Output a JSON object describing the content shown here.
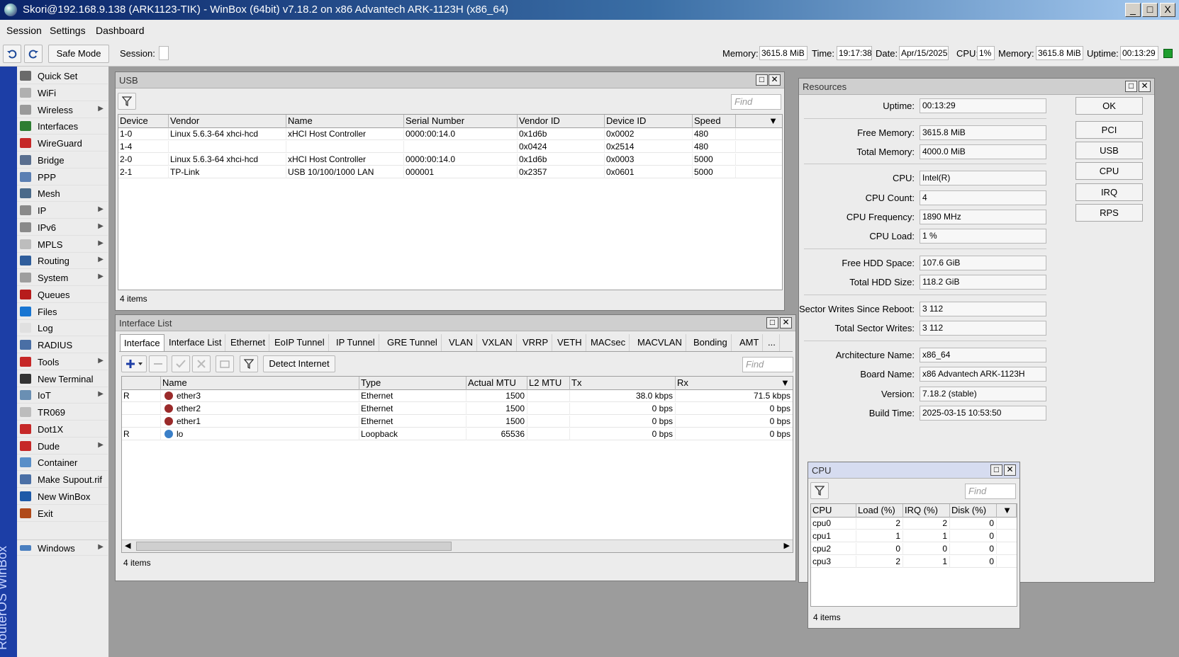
{
  "window": {
    "title": "Skori@192.168.9.138 (ARK1123-TIK) - WinBox (64bit) v7.18.2 on x86 Advantech ARK-1123H (x86_64)",
    "controls": [
      "_",
      "□",
      "X"
    ]
  },
  "menu": [
    "Session",
    "Settings",
    "Dashboard"
  ],
  "toolbar": {
    "undo_icon": "undo-icon",
    "redo_icon": "redo-icon",
    "safe_mode": "Safe Mode",
    "session_label": "Session:",
    "status": {
      "memory_label": "Memory:",
      "memory": "3615.8 MiB",
      "time_label": "Time:",
      "time": "19:17:38",
      "date_label": "Date:",
      "date": "Apr/15/2025",
      "cpu_label": "CPU:",
      "cpu": "1%",
      "memory2_label": "Memory:",
      "memory2": "3615.8 MiB",
      "uptime_label": "Uptime:",
      "uptime": "00:13:29"
    }
  },
  "brand": "RouterOS WinBox",
  "sidebar": [
    {
      "label": "Quick Set",
      "icon": "wand-icon",
      "color": "#6a6a6a",
      "arrow": false
    },
    {
      "label": "WiFi",
      "icon": "wifi-icon",
      "color": "#b0b0b0",
      "arrow": false
    },
    {
      "label": "Wireless",
      "icon": "antenna-icon",
      "color": "#9a9a9a",
      "arrow": true
    },
    {
      "label": "Interfaces",
      "icon": "interfaces-icon",
      "color": "#2e7d32",
      "arrow": false
    },
    {
      "label": "WireGuard",
      "icon": "wireguard-icon",
      "color": "#c62828",
      "arrow": false
    },
    {
      "label": "Bridge",
      "icon": "bridge-icon",
      "color": "#5a6f8f",
      "arrow": false
    },
    {
      "label": "PPP",
      "icon": "ppp-icon",
      "color": "#5b7fb3",
      "arrow": false
    },
    {
      "label": "Mesh",
      "icon": "mesh-icon",
      "color": "#4a6a8a",
      "arrow": false
    },
    {
      "label": "IP",
      "icon": "ip-icon",
      "color": "#8a8a8a",
      "arrow": true
    },
    {
      "label": "IPv6",
      "icon": "ipv6-icon",
      "color": "#8a8a8a",
      "arrow": true
    },
    {
      "label": "MPLS",
      "icon": "mpls-icon",
      "color": "#bdbdbd",
      "arrow": true
    },
    {
      "label": "Routing",
      "icon": "routing-icon",
      "color": "#2f5d9b",
      "arrow": true
    },
    {
      "label": "System",
      "icon": "gear-icon",
      "color": "#9e9e9e",
      "arrow": true
    },
    {
      "label": "Queues",
      "icon": "queues-icon",
      "color": "#b71c1c",
      "arrow": false
    },
    {
      "label": "Files",
      "icon": "folder-icon",
      "color": "#1976d2",
      "arrow": false
    },
    {
      "label": "Log",
      "icon": "log-icon",
      "color": "#e0e0e0",
      "arrow": false
    },
    {
      "label": "RADIUS",
      "icon": "radius-icon",
      "color": "#4a6fa5",
      "arrow": false
    },
    {
      "label": "Tools",
      "icon": "tools-icon",
      "color": "#c62828",
      "arrow": true
    },
    {
      "label": "New Terminal",
      "icon": "terminal-icon",
      "color": "#333333",
      "arrow": false
    },
    {
      "label": "IoT",
      "icon": "iot-icon",
      "color": "#6a8fb3",
      "arrow": true
    },
    {
      "label": "TR069",
      "icon": "tr069-icon",
      "color": "#bdbdbd",
      "arrow": false
    },
    {
      "label": "Dot1X",
      "icon": "dot1x-icon",
      "color": "#c62828",
      "arrow": false
    },
    {
      "label": "Dude",
      "icon": "dude-icon",
      "color": "#c62828",
      "arrow": true
    },
    {
      "label": "Container",
      "icon": "container-icon",
      "color": "#5a8fc8",
      "arrow": false
    },
    {
      "label": "Make Supout.rif",
      "icon": "supout-icon",
      "color": "#4a6fa5",
      "arrow": false
    },
    {
      "label": "New WinBox",
      "icon": "winbox-icon",
      "color": "#1e5aa8",
      "arrow": false
    },
    {
      "label": "Exit",
      "icon": "exit-icon",
      "color": "#b04a1a",
      "arrow": false
    }
  ],
  "sidebar_windows": {
    "label": "Windows",
    "icon": "windows-icon",
    "color": "#4a7fc0"
  },
  "usb": {
    "title": "USB",
    "find_placeholder": "Find",
    "columns": [
      "Device",
      "Vendor",
      "Name",
      "Serial Number",
      "Vendor ID",
      "Device ID",
      "Speed"
    ],
    "rows": [
      [
        "1-0",
        "Linux 5.6.3-64 xhci-hcd",
        "xHCI Host Controller",
        "0000:00:14.0",
        "0x1d6b",
        "0x0002",
        "480"
      ],
      [
        "1-4",
        "",
        "",
        "",
        "0x0424",
        "0x2514",
        "480"
      ],
      [
        "2-0",
        "Linux 5.6.3-64 xhci-hcd",
        "xHCI Host Controller",
        "0000:00:14.0",
        "0x1d6b",
        "0x0003",
        "5000"
      ],
      [
        "2-1",
        "TP-Link",
        "USB 10/100/1000 LAN",
        "000001",
        "0x2357",
        "0x0601",
        "5000"
      ]
    ],
    "count": "4 items"
  },
  "iface": {
    "title": "Interface List",
    "tabs": [
      "Interface",
      "Interface List",
      "Ethernet",
      "EoIP Tunnel",
      "IP Tunnel",
      "GRE Tunnel",
      "VLAN",
      "VXLAN",
      "VRRP",
      "VETH",
      "MACsec",
      "MACVLAN",
      "Bonding",
      "AMT",
      "..."
    ],
    "detect_internet": "Detect Internet",
    "find_placeholder": "Find",
    "columns": [
      "",
      "Name",
      "Type",
      "Actual MTU",
      "L2 MTU",
      "Tx",
      "Rx"
    ],
    "rows": [
      {
        "flag": "R",
        "name": "ether3",
        "type": "Ethernet",
        "mtu": "1500",
        "l2mtu": "",
        "tx": "38.0 kbps",
        "rx": "71.5 kbps",
        "icon": "ethernet-icon"
      },
      {
        "flag": "",
        "name": "ether2",
        "type": "Ethernet",
        "mtu": "1500",
        "l2mtu": "",
        "tx": "0 bps",
        "rx": "0 bps",
        "icon": "ethernet-icon"
      },
      {
        "flag": "",
        "name": "ether1",
        "type": "Ethernet",
        "mtu": "1500",
        "l2mtu": "",
        "tx": "0 bps",
        "rx": "0 bps",
        "icon": "ethernet-icon"
      },
      {
        "flag": "R",
        "name": "lo",
        "type": "Loopback",
        "mtu": "65536",
        "l2mtu": "",
        "tx": "0 bps",
        "rx": "0 bps",
        "icon": "loopback-icon"
      }
    ],
    "count": "4 items"
  },
  "resources": {
    "title": "Resources",
    "fields": [
      {
        "label": "Uptime:",
        "value": "00:13:29"
      },
      {
        "label": "Free Memory:",
        "value": "3615.8 MiB"
      },
      {
        "label": "Total Memory:",
        "value": "4000.0 MiB"
      },
      {
        "label": "CPU:",
        "value": "Intel(R)"
      },
      {
        "label": "CPU Count:",
        "value": "4"
      },
      {
        "label": "CPU Frequency:",
        "value": "1890 MHz"
      },
      {
        "label": "CPU Load:",
        "value": "1 %"
      },
      {
        "label": "Free HDD Space:",
        "value": "107.6 GiB"
      },
      {
        "label": "Total HDD Size:",
        "value": "118.2 GiB"
      },
      {
        "label": "Sector Writes Since Reboot:",
        "value": "3 112"
      },
      {
        "label": "Total Sector Writes:",
        "value": "3 112"
      },
      {
        "label": "Architecture Name:",
        "value": "x86_64"
      },
      {
        "label": "Board Name:",
        "value": "x86 Advantech ARK-1123H"
      },
      {
        "label": "Version:",
        "value": "7.18.2 (stable)"
      },
      {
        "label": "Build Time:",
        "value": "2025-03-15 10:53:50"
      }
    ],
    "buttons": [
      "OK",
      "PCI",
      "USB",
      "CPU",
      "IRQ",
      "RPS"
    ]
  },
  "cpu": {
    "title": "CPU",
    "find_placeholder": "Find",
    "columns": [
      "CPU",
      "Load (%)",
      "IRQ (%)",
      "Disk (%)"
    ],
    "rows": [
      [
        "cpu0",
        "2",
        "2",
        "0"
      ],
      [
        "cpu1",
        "1",
        "1",
        "0"
      ],
      [
        "cpu2",
        "0",
        "0",
        "0"
      ],
      [
        "cpu3",
        "2",
        "1",
        "0"
      ]
    ],
    "count": "4 items"
  }
}
